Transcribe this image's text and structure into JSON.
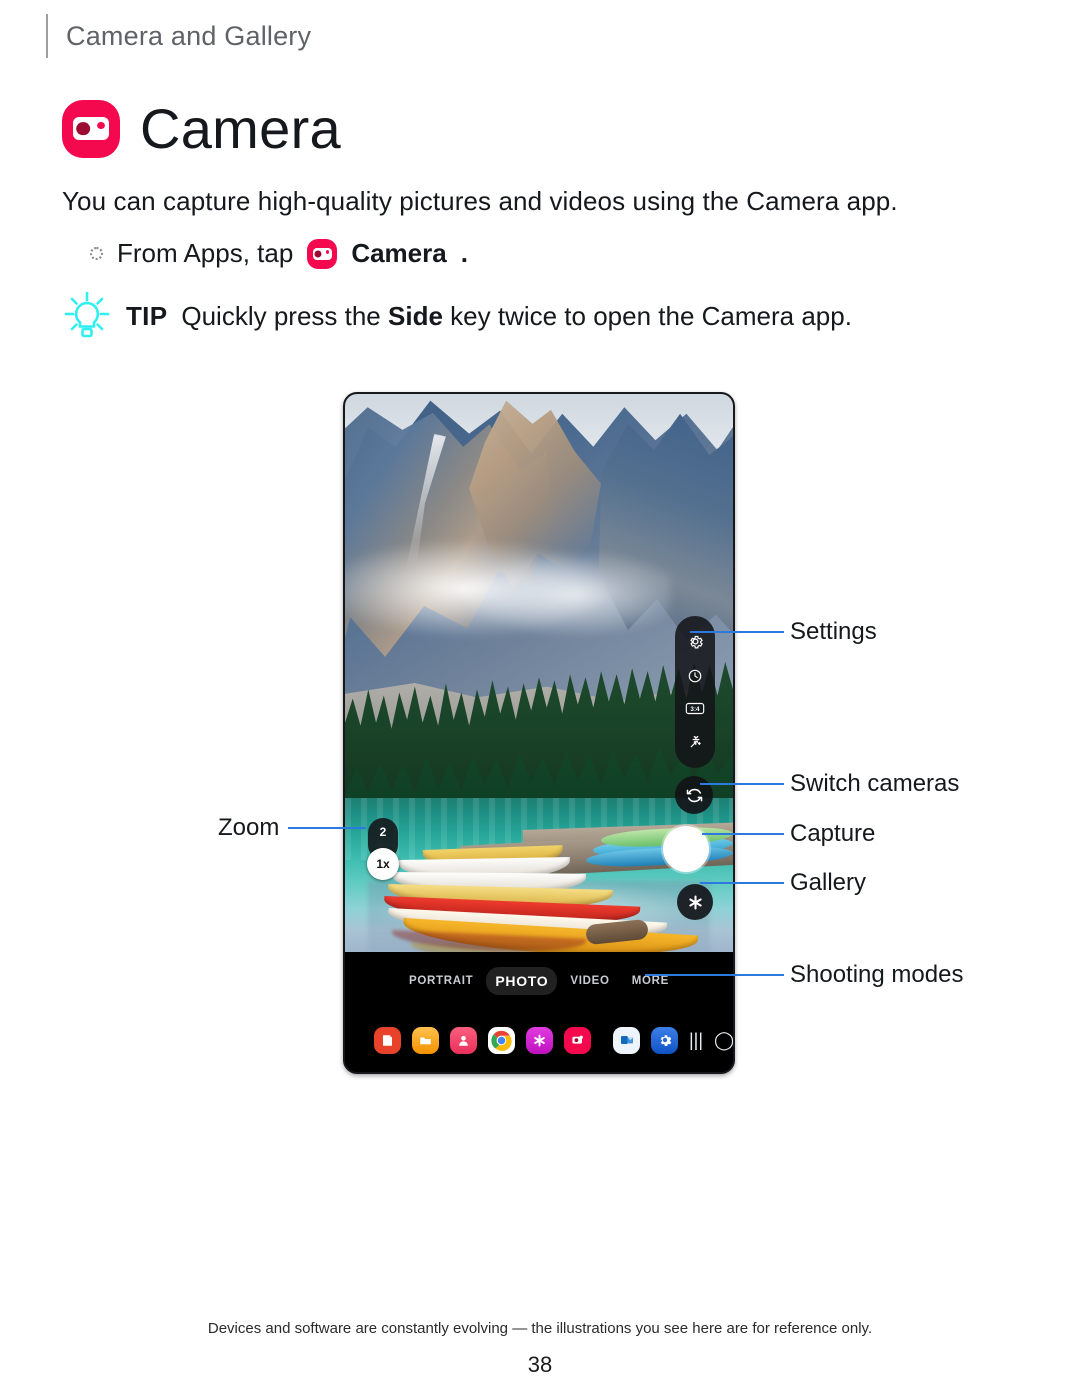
{
  "running_head": {
    "text": "Camera and Gallery"
  },
  "title": {
    "text": "Camera",
    "icon": "camera-app-icon",
    "icon_color": "#f5094e"
  },
  "intro": {
    "text": "You can capture high-quality pictures and videos using the Camera app."
  },
  "bullet": {
    "icon": "hollow-bullet-icon",
    "text_before": "From Apps, tap",
    "app_icon": "camera-app-icon",
    "app_name": "Camera",
    "text_after": "."
  },
  "tip": {
    "icon": "lightbulb-icon",
    "icon_color": "#2ff0f0",
    "label": "TIP",
    "text_before": "Quickly press the",
    "emphasis": "Side",
    "text_after": "key twice to open the Camera app."
  },
  "device": {
    "viewfinder_alt": "mountain lake with colorful canoes at a dock",
    "toolbar": [
      {
        "name": "settings-icon",
        "label": "Settings"
      },
      {
        "name": "timer-icon",
        "label": "Timer"
      },
      {
        "name": "aspect-ratio-icon",
        "label": "3:4"
      },
      {
        "name": "effects-icon",
        "label": "Effects"
      }
    ],
    "aspect_ratio_text": "3:4",
    "zoom": {
      "step_label": "2",
      "current_label": "1x"
    },
    "buttons": {
      "switch_cameras": "Switch cameras",
      "capture": "Capture",
      "gallery": "Gallery"
    },
    "shooting_modes": [
      {
        "label": "PORTRAIT",
        "active": false
      },
      {
        "label": "PHOTO",
        "active": true
      },
      {
        "label": "VIDEO",
        "active": false
      },
      {
        "label": "MORE",
        "active": false
      }
    ],
    "taskbar": {
      "apps_grid": "apps-grid-icon",
      "icons": [
        {
          "name": "samsung-notes-icon",
          "color": "#e8422a"
        },
        {
          "name": "my-files-icon",
          "color": "#f5a623"
        },
        {
          "name": "contacts-icon",
          "color": "#f0456b"
        },
        {
          "name": "chrome-icon",
          "color": "#ffffff"
        },
        {
          "name": "gallery-icon",
          "color": "#d41ad4"
        },
        {
          "name": "camera-icon",
          "color": "#f5094e"
        }
      ],
      "icons_right": [
        {
          "name": "outlook-icon",
          "color": "#e8f0fb"
        },
        {
          "name": "settings-icon",
          "color": "#1f63d6"
        }
      ],
      "nav": [
        {
          "name": "recents-nav-icon",
          "glyph": "|||"
        },
        {
          "name": "home-nav-icon",
          "glyph": "◯"
        },
        {
          "name": "back-nav-icon",
          "glyph": "‹"
        }
      ]
    }
  },
  "callouts": {
    "zoom": "Zoom",
    "settings": "Settings",
    "switch_cameras": "Switch cameras",
    "capture": "Capture",
    "gallery": "Gallery",
    "shooting_modes": "Shooting modes",
    "line_color": "#2c7ae0"
  },
  "footer": {
    "note": "Devices and software are constantly evolving — the illustrations you see here are for reference only.",
    "page_number": "38"
  }
}
